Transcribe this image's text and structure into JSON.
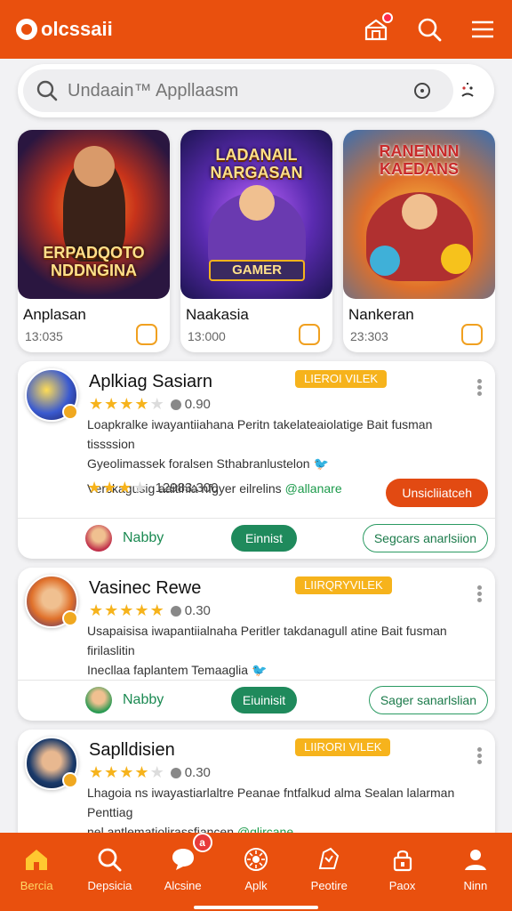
{
  "app": {
    "logo_text": "olcssaii"
  },
  "search": {
    "placeholder": "Undaain™ Appllaasm"
  },
  "featured": [
    {
      "art_title": "ERPADQOTO NDDNGINA",
      "name": "Anplasan",
      "count": "13:035"
    },
    {
      "art_title": "LADANAIL NARGASAN",
      "art_badge": "GAMER",
      "name": "Naakasia",
      "count": "13:000"
    },
    {
      "art_title": "RANENNN KAEDANS",
      "name": "Nankeran",
      "count": "23:303"
    }
  ],
  "apps": [
    {
      "title": "Aplkiag Sasiarn",
      "tag": "LIEROI VILEK",
      "rating_text": "0.90",
      "desc_line1": "Loapkralke iwayantiiahana Peritn takelateaiolatige Bait fusman tissssion",
      "desc_line2": "Gyeolimassek foralsen Sthabranlustelon",
      "desc_line3": "Verckagusig aaitihia nfgyer eilrelins",
      "handle": "@allanare",
      "sub_rating": "12983:300",
      "primary_button": "Unsicliiatceh",
      "user": "Nabby",
      "green_button": "Einnist",
      "outline_button": "Segcars anarlsiion"
    },
    {
      "title": "Vasinec Rewe",
      "tag": "LIIRQRYVILEK",
      "rating_text": "0.30",
      "desc_line1": "Usapaisisa iwapantiialnaha Peritler takdanagull atine Bait fusman firilaslitin",
      "desc_line2": "Inecllaa faplantem Temaaglia",
      "user": "Nabby",
      "green_button": "Eiuinisit",
      "outline_button": "Sager sanarlslian"
    },
    {
      "title": "Saplldisien",
      "tag": "LIIRORI VILEK",
      "rating_text": "0.30",
      "desc_line1": "Lhagoia ns iwayastiarlaltre Peanae fntfalkud alma Sealan lalarman Penttiag",
      "desc_line2": "nel antlematiolirassfiancen",
      "handle": "@glircane"
    }
  ],
  "nav": [
    {
      "label": "Bercia",
      "icon": "home-icon",
      "active": true
    },
    {
      "label": "Depsicia",
      "icon": "search-icon"
    },
    {
      "label": "Alcsine",
      "icon": "chat-icon",
      "badge": "a"
    },
    {
      "label": "Aplk",
      "icon": "sun-icon"
    },
    {
      "label": "Peotire",
      "icon": "map-icon"
    },
    {
      "label": "Paox",
      "icon": "lock-icon"
    },
    {
      "label": "Ninn",
      "icon": "user-icon"
    }
  ],
  "colors": {
    "brand": "#e9500e",
    "accent": "#f6b31c",
    "green": "#1f8a5c"
  }
}
